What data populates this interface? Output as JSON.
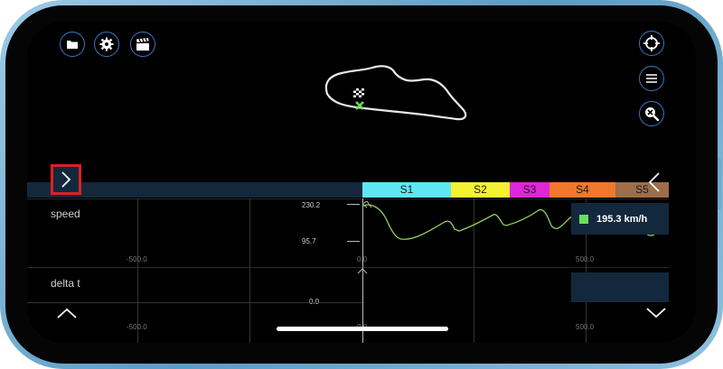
{
  "toolbar": {
    "left_icons": [
      "folder-icon",
      "gear-icon",
      "clapperboard-icon"
    ],
    "right_icons": [
      "crosshair-icon",
      "menu-icon",
      "zoom-track-icon"
    ]
  },
  "sectors": [
    {
      "label": "S1",
      "color": "#5ee7f2"
    },
    {
      "label": "S2",
      "color": "#f5f234"
    },
    {
      "label": "S3",
      "color": "#e026d8"
    },
    {
      "label": "S4",
      "color": "#f0782c"
    },
    {
      "label": "S5",
      "color": "#9e6e48"
    }
  ],
  "speed_panel": {
    "title": "speed",
    "y_max": "230.2",
    "y_min": "95.7",
    "readout": "195.3 km/h",
    "readout_color": "#6bdc5a",
    "x_ticks": [
      "-500.0",
      "0.0",
      "500.0"
    ]
  },
  "delta_panel": {
    "title": "delta t",
    "y_zero": "0.0",
    "x_ticks": [
      "-500.0",
      "0.0",
      "500.0"
    ]
  },
  "colors": {
    "accent": "#3a78c7",
    "trace": "#8fd05a",
    "highlight": "#e02020"
  }
}
